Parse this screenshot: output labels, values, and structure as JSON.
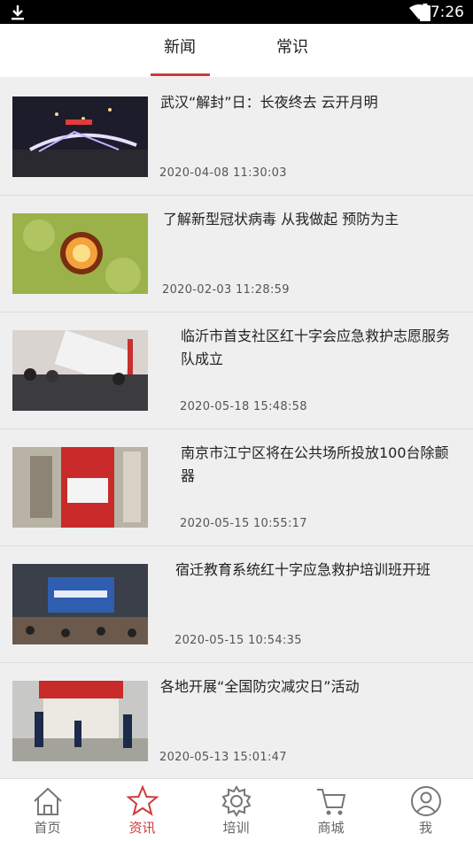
{
  "status_bar": {
    "time": "7:26"
  },
  "tabs": [
    {
      "label": "新闻",
      "active": true
    },
    {
      "label": "常识",
      "active": false
    }
  ],
  "accent_color": "#d03a3a",
  "news": [
    {
      "title": "武汉“解封”日：长夜终去 云开月明",
      "date": "2020-04-08 11:30:03"
    },
    {
      "title": "了解新型冠状病毒 从我做起 预防为主",
      "date": "2020-02-03 11:28:59"
    },
    {
      "title": "临沂市首支社区红十字会应急救护志愿服务队成立",
      "date": "2020-05-18 15:48:58"
    },
    {
      "title": "南京市江宁区将在公共场所投放100台除颤器",
      "date": "2020-05-15 10:55:17"
    },
    {
      "title": "宿迁教育系统红十字应急救护培训班开班",
      "date": "2020-05-15 10:54:35"
    },
    {
      "title": "各地开展“全国防灾减灾日”活动",
      "date": "2020-05-13 15:01:47"
    }
  ],
  "bottom_nav": [
    {
      "label": "首页",
      "icon": "home-icon",
      "active": false
    },
    {
      "label": "资讯",
      "icon": "star-icon",
      "active": true
    },
    {
      "label": "培训",
      "icon": "gear-icon",
      "active": false
    },
    {
      "label": "商城",
      "icon": "cart-icon",
      "active": false
    },
    {
      "label": "我",
      "icon": "user-icon",
      "active": false
    }
  ]
}
